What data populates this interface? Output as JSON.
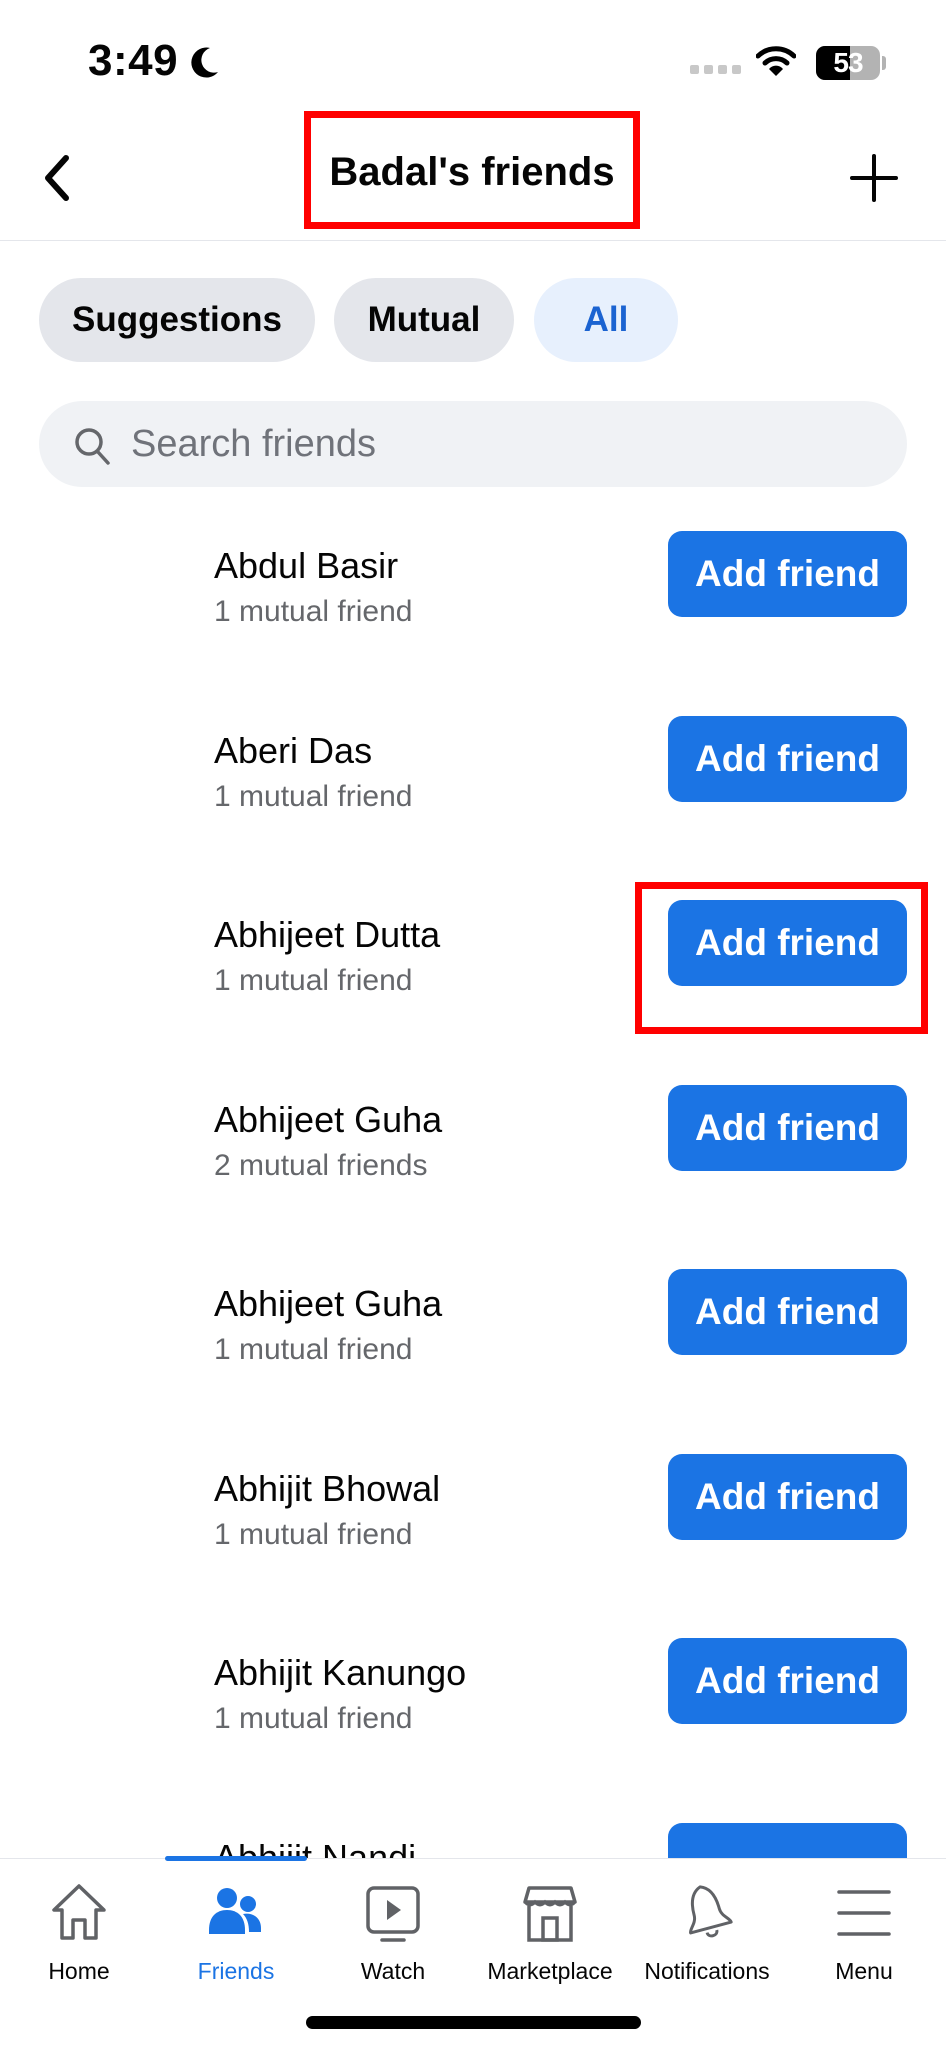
{
  "status_bar": {
    "time": "3:49",
    "battery_percent": "53",
    "battery_level": 0.53,
    "icons": [
      "moon-icon",
      "signal-icon",
      "wifi-icon",
      "battery-icon"
    ]
  },
  "header": {
    "title": "Badal's friends",
    "back_icon": "chevron-left-icon",
    "add_icon": "plus-icon"
  },
  "filters": {
    "chips": [
      {
        "label": "Suggestions",
        "active": false
      },
      {
        "label": "Mutual",
        "active": false
      },
      {
        "label": "All",
        "active": true
      }
    ]
  },
  "search": {
    "placeholder": "Search friends",
    "value": ""
  },
  "friends": [
    {
      "name": "Abdul Basir",
      "mutual": "1 mutual friend",
      "action": "Add friend"
    },
    {
      "name": "Aberi Das",
      "mutual": "1 mutual friend",
      "action": "Add friend"
    },
    {
      "name": "Abhijeet Dutta",
      "mutual": "1 mutual friend",
      "action": "Add friend"
    },
    {
      "name": "Abhijeet Guha",
      "mutual": "2 mutual friends",
      "action": "Add friend"
    },
    {
      "name": "Abhijeet Guha",
      "mutual": "1 mutual friend",
      "action": "Add friend"
    },
    {
      "name": "Abhijit Bhowal",
      "mutual": "1 mutual friend",
      "action": "Add friend"
    },
    {
      "name": "Abhijit Kanungo",
      "mutual": "1 mutual friend",
      "action": "Add friend"
    },
    {
      "name": "Abhijit Nandi",
      "mutual": "",
      "action": ""
    }
  ],
  "tabbar": {
    "tabs": [
      {
        "label": "Home",
        "icon": "home-icon",
        "active": false
      },
      {
        "label": "Friends",
        "icon": "friends-icon",
        "active": true
      },
      {
        "label": "Watch",
        "icon": "watch-icon",
        "active": false
      },
      {
        "label": "Marketplace",
        "icon": "marketplace-icon",
        "active": false
      },
      {
        "label": "Notifications",
        "icon": "bell-icon",
        "active": false
      },
      {
        "label": "Menu",
        "icon": "menu-icon",
        "active": false
      }
    ]
  },
  "colors": {
    "accent": "#1b74e4",
    "active_chip_bg": "#e7f0fd",
    "chip_bg": "#e4e6eb",
    "search_bg": "#f0f2f5",
    "secondary_text": "#65676b",
    "annotation_red": "#ff0000"
  }
}
